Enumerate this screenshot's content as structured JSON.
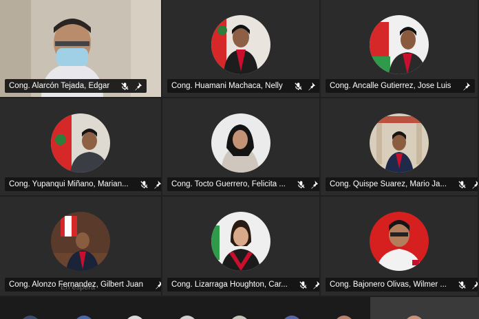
{
  "participants": [
    {
      "name": "Cong. Alarcón Tejada, Edgar",
      "muted": true,
      "pinned": true,
      "has_video": true
    },
    {
      "name": "Cong. Huamani Machaca, Nelly",
      "muted": true,
      "pinned": true,
      "has_video": false
    },
    {
      "name": "Cong. Ancalle Gutierrez, Jose Luis",
      "muted": false,
      "pinned": true,
      "has_video": false
    },
    {
      "name": "Cong. Yupanqui Miñano, Marian...",
      "muted": true,
      "pinned": true,
      "has_video": false
    },
    {
      "name": "Cong. Tocto Guerrero, Felicita ...",
      "muted": true,
      "pinned": true,
      "has_video": false
    },
    {
      "name": "Cong. Quispe Suarez, Mario Ja...",
      "muted": true,
      "pinned": true,
      "has_video": false
    },
    {
      "name": "Cong. Alonzo Fernandez, Gilbert Juan",
      "muted": false,
      "pinned": true,
      "has_video": false
    },
    {
      "name": "Cong. Lizarraga Houghton, Car...",
      "muted": true,
      "pinned": true,
      "has_video": false
    },
    {
      "name": "Cong. Bajonero Olivas, Wilmer ...",
      "muted": true,
      "pinned": true,
      "has_video": false
    }
  ],
  "overlay_text": "En espera",
  "colors": {
    "background": "#1f1f1f",
    "tile": "#2b2b2b",
    "nameplate": "#141414",
    "flag_red": "#d62828",
    "sash_red": "#c8102e"
  },
  "icons": {
    "muted": "microphone-muted-icon",
    "pin": "pin-icon"
  }
}
